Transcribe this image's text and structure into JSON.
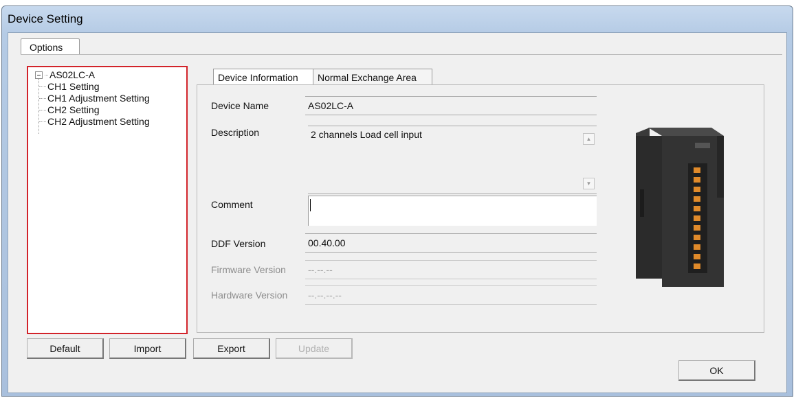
{
  "window": {
    "title": "Device Setting"
  },
  "outer_tab": {
    "label": "Options"
  },
  "tree": {
    "root": "AS02LC-A",
    "items": [
      "CH1 Setting",
      "CH1 Adjustment Setting",
      "CH2 Setting",
      "CH2 Adjustment Setting"
    ]
  },
  "tabs": [
    {
      "label": "Device Information",
      "active": true
    },
    {
      "label": "Normal Exchange Area",
      "active": false
    }
  ],
  "fields": {
    "device_name": {
      "label": "Device Name",
      "value": "AS02LC-A"
    },
    "description": {
      "label": "Description",
      "value": "2 channels Load cell input"
    },
    "comment": {
      "label": "Comment",
      "value": ""
    },
    "ddf_version": {
      "label": "DDF Version",
      "value": "00.40.00"
    },
    "firmware_version": {
      "label": "Firmware Version",
      "value": "--.--.--"
    },
    "hardware_version": {
      "label": "Hardware Version",
      "value": "--.--.--.--"
    }
  },
  "buttons": {
    "default": "Default",
    "import": "Import",
    "export": "Export",
    "update": "Update",
    "ok": "OK"
  },
  "colors": {
    "tree_highlight_border": "#d2232a",
    "title_bar": "#b5cbe5"
  }
}
